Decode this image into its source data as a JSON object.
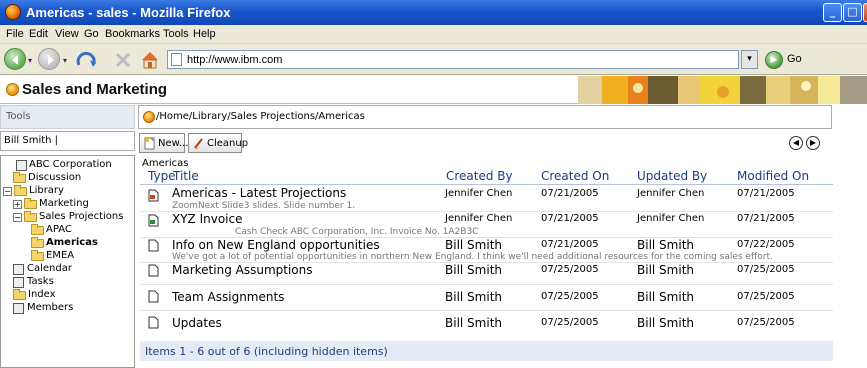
{
  "window": {
    "title": "Americas - sales - Mozilla Firefox",
    "min_glyph": "_",
    "max_glyph": "□",
    "close_glyph": "X"
  },
  "menu": {
    "file": "File",
    "edit": "Edit",
    "view": "View",
    "go": "Go",
    "bookmarks": "Bookmarks",
    "tools": "Tools",
    "help": "Help"
  },
  "nav": {
    "url": "http://www.ibm.com",
    "go_label": "Go",
    "caret": "▾"
  },
  "app": {
    "title": "Sales and Marketing"
  },
  "sidebar": {
    "tools_label": "Tools",
    "user_label": "Bill Smith  |",
    "tree": [
      {
        "label": "ABC Corporation"
      },
      {
        "label": "Discussion"
      },
      {
        "label": "Library"
      },
      {
        "label": "Marketing"
      },
      {
        "label": "Sales Projections"
      },
      {
        "label": "APAC"
      },
      {
        "label": "Americas"
      },
      {
        "label": "EMEA"
      },
      {
        "label": "Calendar"
      },
      {
        "label": "Tasks"
      },
      {
        "label": "Index"
      },
      {
        "label": "Members"
      }
    ]
  },
  "path": {
    "text": "/Home/Library/Sales Projections/Americas"
  },
  "toolbar": {
    "new_label": "New...",
    "cleanup_label": "Cleanup"
  },
  "list": {
    "folder_name": "Americas",
    "columns": {
      "type": "Type",
      "title": "Title",
      "created_by": "Created By",
      "created_on": "Created On",
      "updated_by": "Updated By",
      "modified_on": "Modified On"
    },
    "rows": [
      {
        "title": "Americas - Latest Projections",
        "subtitle": "ZoomNext Slide3 slides. Slide number 1.",
        "created_by": "Jennifer Chen",
        "created_on": "07/21/2005",
        "updated_by": "Jennifer Chen",
        "modified_on": "07/21/2005"
      },
      {
        "title": "XYZ Invoice",
        "subtitle": "Cash   Check   ABC Corporation, Inc.  Invoice No. 1A2B3C",
        "created_by": "Jennifer Chen",
        "created_on": "07/21/2005",
        "updated_by": "Jennifer Chen",
        "modified_on": "07/21/2005"
      },
      {
        "title": "Info on New England opportunities",
        "subtitle": "We've got a lot of potential opportunities in northern New England.  I think we'll need additional resources for the coming sales effort.",
        "created_by": "Bill Smith",
        "created_on": "07/21/2005",
        "updated_by": "Bill Smith",
        "modified_on": "07/22/2005"
      },
      {
        "title": "Marketing Assumptions",
        "subtitle": "",
        "created_by": "Bill Smith",
        "created_on": "07/25/2005",
        "updated_by": "Bill Smith",
        "modified_on": "07/25/2005"
      },
      {
        "title": "Team Assignments",
        "subtitle": "",
        "created_by": "Bill Smith",
        "created_on": "07/25/2005",
        "updated_by": "Bill Smith",
        "modified_on": "07/25/2005"
      },
      {
        "title": "Updates",
        "subtitle": "",
        "created_by": "Bill Smith",
        "created_on": "07/25/2005",
        "updated_by": "Bill Smith",
        "modified_on": "07/25/2005"
      }
    ],
    "footer": "Items 1 - 6 out of 6 (including hidden items)"
  },
  "colors": {
    "titlebar": "#1956c9",
    "header_text": "#1b3c80",
    "footer_bg": "#e4ebf4"
  }
}
